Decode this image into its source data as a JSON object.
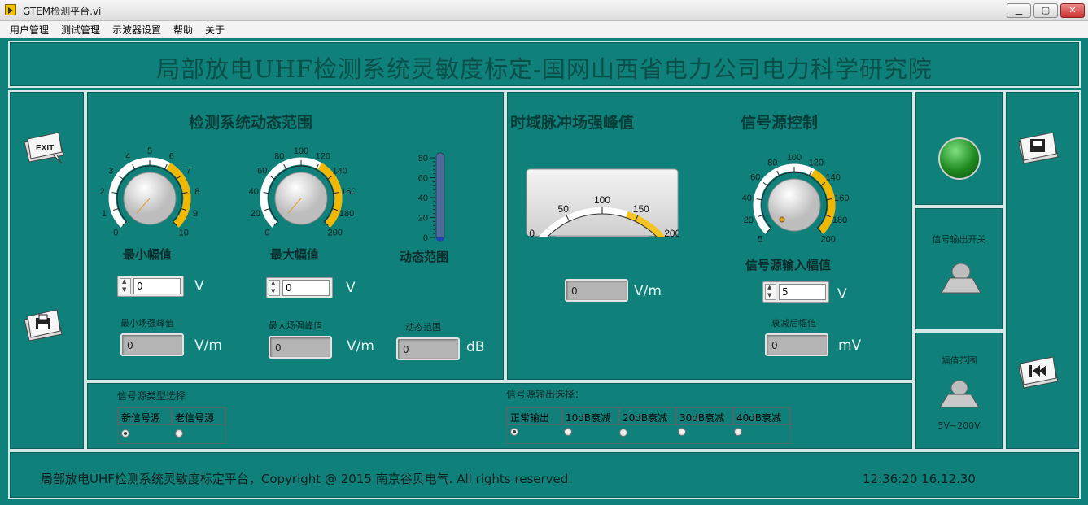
{
  "window": {
    "title": "GTEM检测平台.vi",
    "minimize": "▁",
    "restore": "▢",
    "close": "✕"
  },
  "menu": [
    "用户管理",
    "测试管理",
    "示波器设置",
    "帮助",
    "关于"
  ],
  "banner": {
    "title": "局部放电UHF检测系统灵敏度标定-国网山西省电力公司电力科学研究院"
  },
  "sections": {
    "dynamic_range": "检测系统动态范围",
    "pulse_peak": "时域脉冲场强峰值",
    "source_control": "信号源控制"
  },
  "knob_min": {
    "ticks": [
      "0",
      "1",
      "2",
      "3",
      "4",
      "5",
      "6",
      "7",
      "8",
      "9",
      "10"
    ],
    "label": "最小幅值",
    "value": "0",
    "unit": "V",
    "ind_label": "最小场强峰值",
    "ind_value": "0",
    "ind_unit": "V/m"
  },
  "knob_max": {
    "ticks": [
      "0",
      "20",
      "40",
      "60",
      "80",
      "100",
      "120",
      "140",
      "160",
      "180",
      "200"
    ],
    "label": "最大幅值",
    "value": "0",
    "unit": "V",
    "ind_label": "最大场强峰值",
    "ind_value": "0",
    "ind_unit": "V/m"
  },
  "thermo": {
    "ticks": [
      "80",
      "60",
      "40",
      "20",
      "0"
    ],
    "label": "动态范围",
    "ind_label": "动态范围",
    "ind_value": "0",
    "ind_unit": "dB",
    "level": 0
  },
  "meter": {
    "ticks": [
      "0",
      "50",
      "100",
      "150",
      "200"
    ],
    "value": 0,
    "ind_value": "0",
    "unit": "V/m"
  },
  "knob_src": {
    "ticks": [
      "5",
      "20",
      "40",
      "60",
      "80",
      "100",
      "120",
      "140",
      "160",
      "180",
      "200"
    ],
    "label": "信号源输入幅值",
    "value": "5",
    "unit": "V",
    "ind_label": "衰减后幅值",
    "ind_value": "0",
    "ind_unit": "mV"
  },
  "source_type": {
    "label": "信号源类型选择",
    "options": [
      "新信号源",
      "老信号源"
    ],
    "selected": 0
  },
  "output_select": {
    "label": "信号源输出选择：",
    "options": [
      "正常输出",
      "10dB衰减",
      "20dB衰减",
      "30dB衰减",
      "40dB衰减"
    ],
    "selected": 0
  },
  "right": {
    "output_switch": "信号输出开关",
    "range_label": "幅值范围",
    "range_value": "5V~200V"
  },
  "icons": {
    "exit": "EXIT"
  },
  "footer": {
    "copyright": "局部放电UHF检测系统灵敏度标定平台，Copyright @ 2015 南京谷贝电气. All rights reserved.",
    "time": "12:36:20  16.12.30"
  },
  "colors": {
    "panel": "#0f817a",
    "accent": "#f2b800",
    "led": "#1f8a1f"
  }
}
